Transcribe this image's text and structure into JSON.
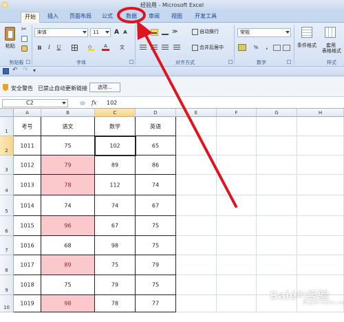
{
  "window": {
    "title": "经验用 - Microsoft Excel"
  },
  "tabs": [
    {
      "label": "开始",
      "active": true
    },
    {
      "label": "插入"
    },
    {
      "label": "页面布局"
    },
    {
      "label": "公式"
    },
    {
      "label": "数据",
      "highlighted": true
    },
    {
      "label": "审阅"
    },
    {
      "label": "视图"
    },
    {
      "label": "开发工具"
    }
  ],
  "ribbon": {
    "clipboard": {
      "paste_label": "粘贴",
      "group_label": "剪贴板"
    },
    "font": {
      "font_name": "宋体",
      "font_size": "11",
      "bold": "B",
      "italic": "I",
      "underline": "U",
      "grow": "A",
      "shrink": "A",
      "color_letter": "A",
      "wen": "文",
      "group_label": "字体"
    },
    "alignment": {
      "wrap_label": "自动换行",
      "merge_label": "合并后居中",
      "group_label": "对齐方式"
    },
    "number": {
      "format": "常规",
      "percent": "%",
      "comma": ",",
      "group_label": "数字"
    },
    "styles": {
      "cond_format": "条件格式",
      "table_format_1": "套用",
      "table_format_2": "表格格式",
      "group_label": "样式"
    }
  },
  "security": {
    "title": "安全警告",
    "message": "已禁止自动更新链接",
    "options_button": "选项..."
  },
  "formula_bar": {
    "name_box": "C2",
    "fx": "fx",
    "value": "102"
  },
  "columns": [
    "A",
    "B",
    "C",
    "D",
    "E",
    "F",
    "G",
    "H"
  ],
  "rows": [
    "1",
    "2",
    "3",
    "4",
    "5",
    "6",
    "7",
    "8",
    "9",
    "10"
  ],
  "table": {
    "headers": [
      "考号",
      "语文",
      "数学",
      "英语"
    ],
    "rows": [
      {
        "id": "1011",
        "chinese": "75",
        "math": "102",
        "english": "65",
        "highlight": false
      },
      {
        "id": "1012",
        "chinese": "79",
        "math": "89",
        "english": "86",
        "highlight": true
      },
      {
        "id": "1013",
        "chinese": "78",
        "math": "112",
        "english": "74",
        "highlight": true
      },
      {
        "id": "1014",
        "chinese": "74",
        "math": "74",
        "english": "67",
        "highlight": false
      },
      {
        "id": "1015",
        "chinese": "96",
        "math": "67",
        "english": "75",
        "highlight": true
      },
      {
        "id": "1016",
        "chinese": "68",
        "math": "98",
        "english": "75",
        "highlight": false
      },
      {
        "id": "1017",
        "chinese": "89",
        "math": "75",
        "english": "79",
        "highlight": true
      },
      {
        "id": "1018",
        "chinese": "75",
        "math": "79",
        "english": "75",
        "highlight": false
      },
      {
        "id": "1019",
        "chinese": "98",
        "math": "78",
        "english": "77",
        "highlight": true
      }
    ]
  },
  "selection": {
    "cell": "C2",
    "column": "C",
    "row": "2"
  },
  "colors": {
    "highlight_fill": "#fbc9cc",
    "highlight_text": "#9b1c1c",
    "annotation": "#e0141e"
  },
  "watermark": {
    "text": "Baiéº¦经验",
    "sub": "jingyan.baidu.com"
  }
}
